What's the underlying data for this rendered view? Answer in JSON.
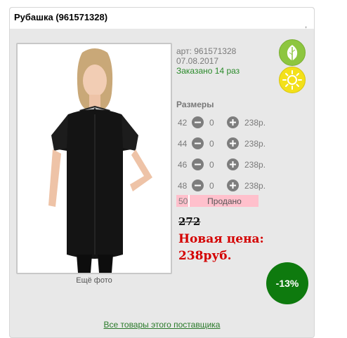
{
  "product": {
    "title": "Рубашка (961571328)",
    "corner_mark": ",",
    "article": "арт: 961571328",
    "date": "07.08.2017",
    "ordered": "Заказано 14 раз",
    "more_photos": "Ещё фото"
  },
  "badges": {
    "eco_icon": "leaf-icon",
    "sun_icon": "sun-icon",
    "eco_color": "#8dc63f",
    "sun_color": "#f3e01a"
  },
  "sizes": {
    "title": "Размеры",
    "rows": [
      {
        "size": "42",
        "qty": "0",
        "price": "238р."
      },
      {
        "size": "44",
        "qty": "0",
        "price": "238р."
      },
      {
        "size": "46",
        "qty": "0",
        "price": "238р."
      },
      {
        "size": "48",
        "qty": "0",
        "price": "238р."
      }
    ],
    "sold_out": {
      "size": "50",
      "label": "Продано"
    }
  },
  "pricing": {
    "old_price": "272",
    "new_price_label": "Новая цена:",
    "new_price": "238руб.",
    "discount": "-13%",
    "discount_color": "#0e7a0e",
    "new_price_color": "#d40000"
  },
  "footer": {
    "all_link": "Все товары этого поставщика"
  }
}
